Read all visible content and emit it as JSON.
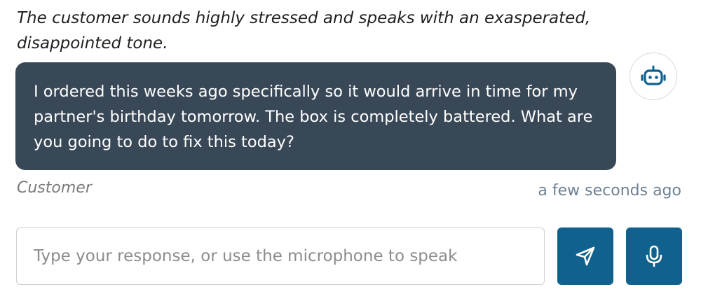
{
  "tone_note": "The customer sounds highly stressed and speaks with an exasperated, disappointed tone.",
  "message": {
    "text": "I ordered this weeks ago specifically so it would arrive in time for my partner's birthday tomorrow. The box is completely battered. What are you going to do to fix this today?",
    "sender": "Customer",
    "timestamp": "a few seconds ago"
  },
  "avatar_icon": "robot-icon",
  "composer": {
    "placeholder": "Type your response, or use the microphone to speak",
    "send_icon": "send-icon",
    "mic_icon": "microphone-icon"
  },
  "colors": {
    "bubble_bg": "#394857",
    "button_bg": "#10618d",
    "timestamp": "#6e8294"
  }
}
